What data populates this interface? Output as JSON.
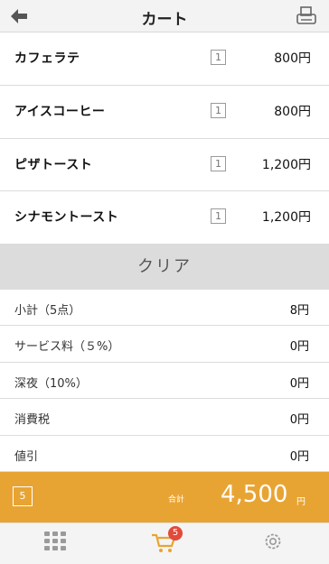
{
  "header": {
    "title": "カート",
    "back_icon": "arrow-left-icon",
    "print_icon": "printer-icon"
  },
  "items": [
    {
      "name": "カフェラテ",
      "qty": "1",
      "price": "800円"
    },
    {
      "name": "アイスコーヒー",
      "qty": "1",
      "price": "800円"
    },
    {
      "name": "ピザトースト",
      "qty": "1",
      "price": "1,200円"
    },
    {
      "name": "シナモントースト",
      "qty": "1",
      "price": "1,200円"
    }
  ],
  "clear_label": "クリア",
  "summary": [
    {
      "label": "小計（5点）",
      "value": "8円"
    },
    {
      "label": "サービス料（５%）",
      "value": "0円"
    },
    {
      "label": "深夜（10%）",
      "value": "0円"
    },
    {
      "label": "消費税",
      "value": "0円"
    },
    {
      "label": "値引",
      "value": "0円"
    }
  ],
  "total": {
    "count": "5",
    "label": "合計",
    "value": "4,500",
    "unit": "円"
  },
  "tabbar": {
    "tabs": [
      {
        "icon": "grid-icon",
        "label": ""
      },
      {
        "icon": "cart-icon",
        "label": "",
        "badge": "5"
      },
      {
        "icon": "gear-icon",
        "label": ""
      }
    ]
  },
  "colors": {
    "accent": "#e8a433",
    "badge": "#e24a3a",
    "clear_bg": "#dcdcdc"
  }
}
